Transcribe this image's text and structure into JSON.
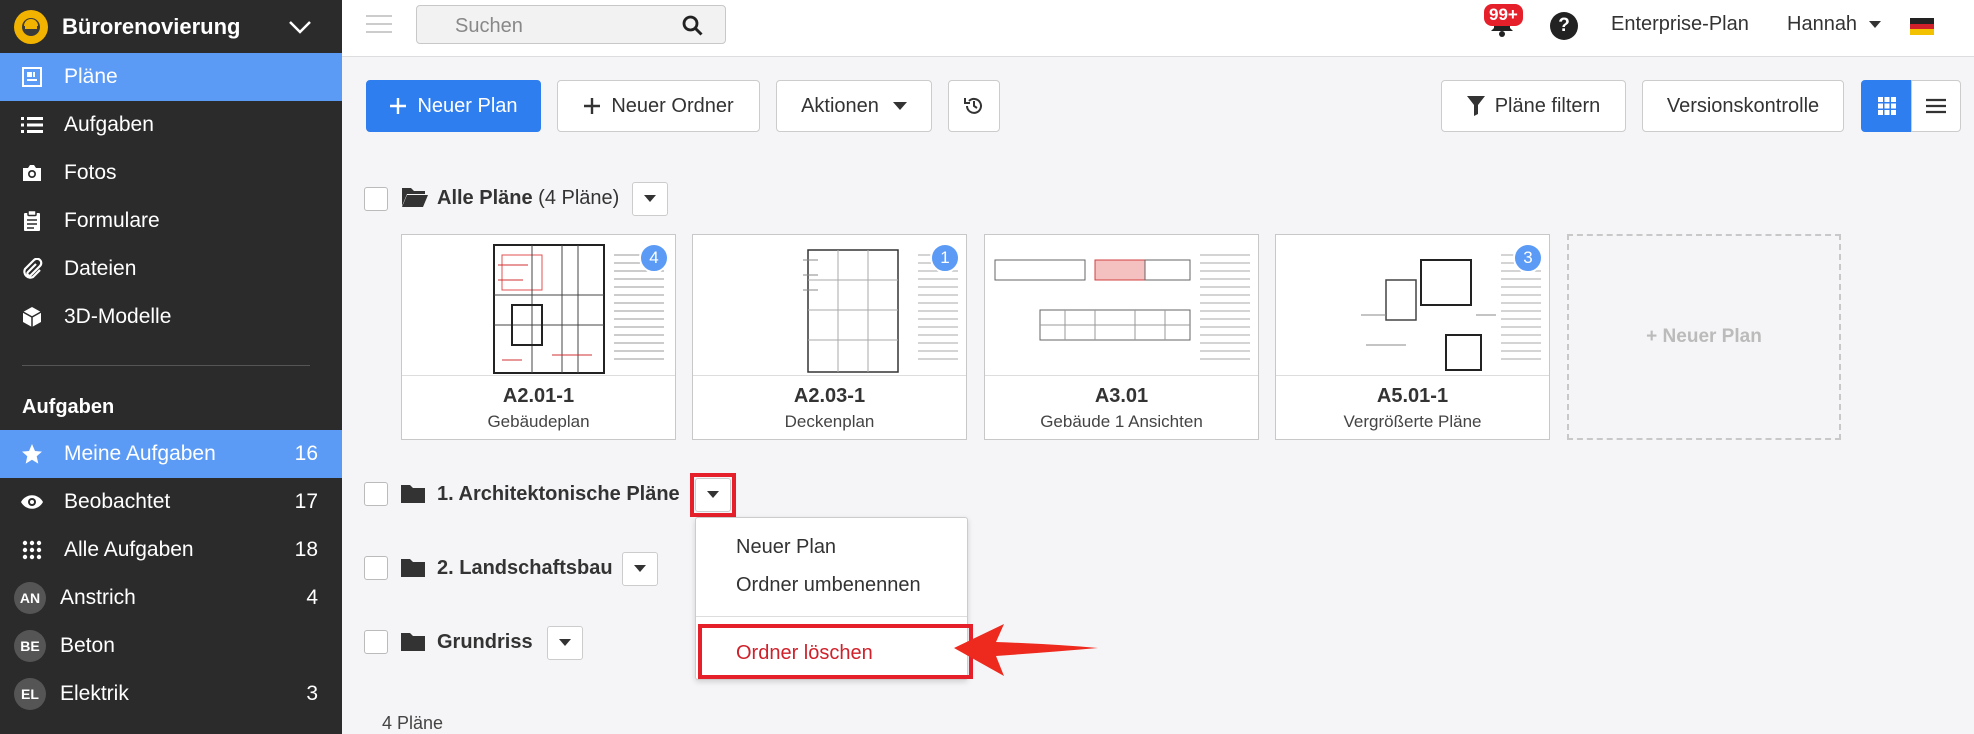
{
  "project": {
    "title": "Bürorenovierung"
  },
  "nav": [
    {
      "label": "Pläne",
      "icon": "plans-icon"
    },
    {
      "label": "Aufgaben",
      "icon": "list-icon"
    },
    {
      "label": "Fotos",
      "icon": "camera-icon"
    },
    {
      "label": "Formulare",
      "icon": "clipboard-icon"
    },
    {
      "label": "Dateien",
      "icon": "paperclip-icon"
    },
    {
      "label": "3D-Modelle",
      "icon": "cube-icon"
    }
  ],
  "tasks_section": {
    "title": "Aufgaben",
    "items": [
      {
        "label": "Meine Aufgaben",
        "count": "16",
        "icon": "star-icon"
      },
      {
        "label": "Beobachtet",
        "count": "17",
        "icon": "eye-icon"
      },
      {
        "label": "Alle Aufgaben",
        "count": "18",
        "icon": "grid-icon"
      },
      {
        "label": "Anstrich",
        "count": "4",
        "badge": "AN"
      },
      {
        "label": "Beton",
        "count": "",
        "badge": "BE"
      },
      {
        "label": "Elektrik",
        "count": "3",
        "badge": "EL"
      }
    ]
  },
  "topbar": {
    "search_placeholder": "Suchen",
    "notifications": "99+",
    "help": "?",
    "plan": "Enterprise-Plan",
    "user": "Hannah"
  },
  "toolbar": {
    "new_plan": "Neuer Plan",
    "new_folder": "Neuer Ordner",
    "actions": "Aktionen",
    "filter": "Pläne filtern",
    "version_control": "Versionskontrolle"
  },
  "all_plans": {
    "label": "Alle Pläne",
    "count": "(4 Pläne)"
  },
  "cards": [
    {
      "code": "A2.01-1",
      "name": "Gebäudeplan",
      "badge": "4"
    },
    {
      "code": "A2.03-1",
      "name": "Deckenplan",
      "badge": "1"
    },
    {
      "code": "A3.01",
      "name": "Gebäude 1 Ansichten",
      "badge": ""
    },
    {
      "code": "A5.01-1",
      "name": "Vergrößerte Pläne",
      "badge": "3"
    }
  ],
  "new_plan_card": "+ Neuer Plan",
  "folders": [
    {
      "label": "1. Architektonische Pläne"
    },
    {
      "label": "2. Landschaftsbau"
    },
    {
      "label": "Grundriss"
    }
  ],
  "menu": {
    "new_plan": "Neuer Plan",
    "rename": "Ordner umbenennen",
    "delete": "Ordner löschen"
  },
  "footer": {
    "count": "4 Pläne"
  },
  "colors": {
    "accent": "#2f7ef0",
    "active_nav": "#5b9bf6",
    "highlight": "#e5202a"
  }
}
